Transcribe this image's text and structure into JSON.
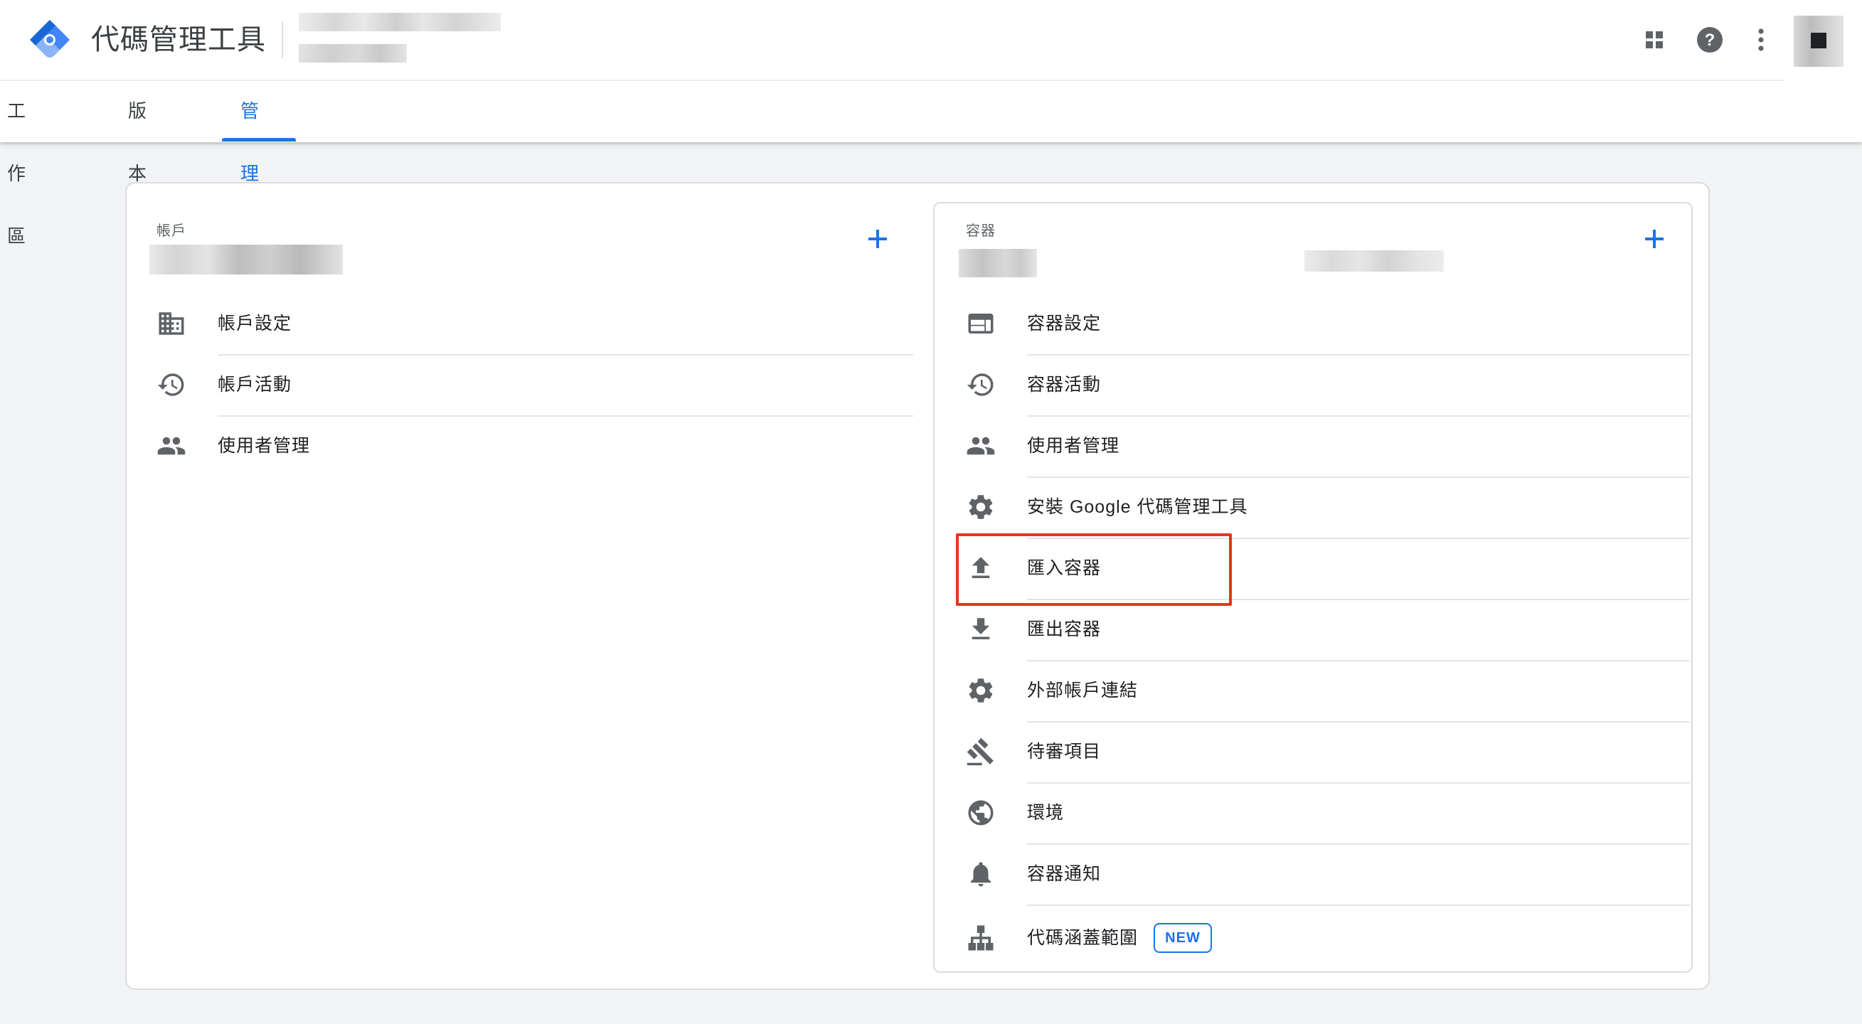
{
  "app": {
    "product_name": "代碼管理工具"
  },
  "top_icons": [
    "apps-grid-icon",
    "help-icon",
    "more-vert-icon",
    "account-avatar"
  ],
  "tabs": [
    {
      "label": "工作區",
      "active": false
    },
    {
      "label": "版本",
      "active": false
    },
    {
      "label": "管理",
      "active": true
    }
  ],
  "account": {
    "label": "帳戶",
    "items": [
      {
        "label": "帳戶設定",
        "icon": "building-icon"
      },
      {
        "label": "帳戶活動",
        "icon": "history-icon"
      },
      {
        "label": "使用者管理",
        "icon": "people-icon"
      }
    ]
  },
  "container": {
    "label": "容器",
    "items": [
      {
        "label": "容器設定",
        "icon": "web-icon"
      },
      {
        "label": "容器活動",
        "icon": "history-icon"
      },
      {
        "label": "使用者管理",
        "icon": "people-icon"
      },
      {
        "label": "安裝 Google 代碼管理工具",
        "icon": "gear-icon"
      },
      {
        "label": "匯入容器",
        "icon": "upload-icon",
        "highlighted": true
      },
      {
        "label": "匯出容器",
        "icon": "download-icon"
      },
      {
        "label": "外部帳戶連結",
        "icon": "gear-icon"
      },
      {
        "label": "待審項目",
        "icon": "gavel-icon"
      },
      {
        "label": "環境",
        "icon": "globe-icon"
      },
      {
        "label": "容器通知",
        "icon": "bell-icon"
      },
      {
        "label": "代碼涵蓋範圍",
        "icon": "sitemap-icon",
        "badge": "NEW"
      }
    ]
  },
  "colors": {
    "accent": "#1a73e8",
    "highlight": "#e8341c",
    "icon": "#5f6368"
  }
}
